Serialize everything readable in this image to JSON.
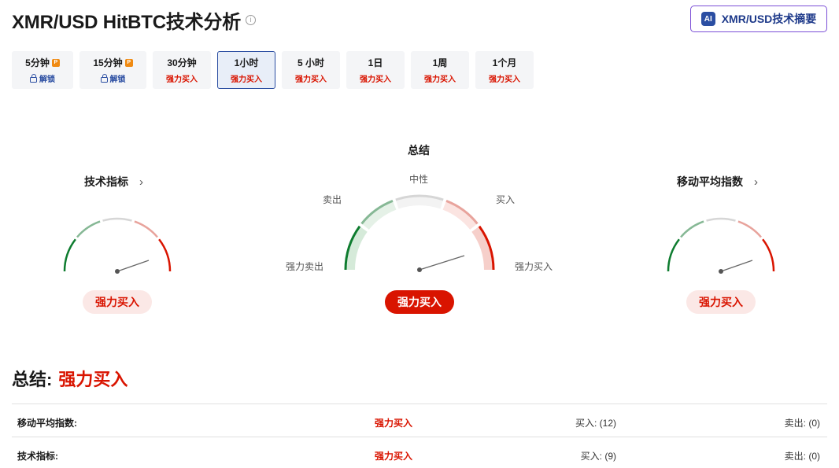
{
  "header": {
    "title": "XMR/USD HitBTC技术分析",
    "ai_badge": "AI",
    "ai_button": "XMR/USD技术摘要"
  },
  "tabs": [
    {
      "label": "5分钟",
      "sub": "解锁",
      "locked": true
    },
    {
      "label": "15分钟",
      "sub": "解锁",
      "locked": true
    },
    {
      "label": "30分钟",
      "sub": "强力买入",
      "locked": false
    },
    {
      "label": "1小时",
      "sub": "强力买入",
      "locked": false,
      "active": true
    },
    {
      "label": "5 小时",
      "sub": "强力买入",
      "locked": false
    },
    {
      "label": "1日",
      "sub": "强力买入",
      "locked": false
    },
    {
      "label": "1周",
      "sub": "强力买入",
      "locked": false
    },
    {
      "label": "1个月",
      "sub": "强力买入",
      "locked": false
    }
  ],
  "gauges": {
    "indicators": {
      "title": "技术指标",
      "result": "强力买入",
      "level": "strong-buy"
    },
    "summary": {
      "title": "总结",
      "result": "强力买入",
      "level": "strong-buy",
      "labels": {
        "neutral": "中性",
        "sell": "卖出",
        "buy": "买入",
        "strong_sell": "强力卖出",
        "strong_buy": "强力买入"
      }
    },
    "moving_averages": {
      "title": "移动平均指数",
      "result": "强力买入",
      "level": "strong-buy"
    }
  },
  "summary": {
    "heading": "总结:",
    "value": "强力买入",
    "rows": [
      {
        "name": "移动平均指数:",
        "value": "强力买入",
        "buy": "买入: (12)",
        "sell": "卖出: (0)"
      },
      {
        "name": "技术指标:",
        "value": "强力买入",
        "buy": "买入: (9)",
        "sell": "卖出: (0)"
      }
    ]
  },
  "colors": {
    "strong_buy": "#d91400",
    "brand_blue": "#2b4ea2",
    "ai_border": "#7b4fd6",
    "green": "#0e7c2f"
  }
}
